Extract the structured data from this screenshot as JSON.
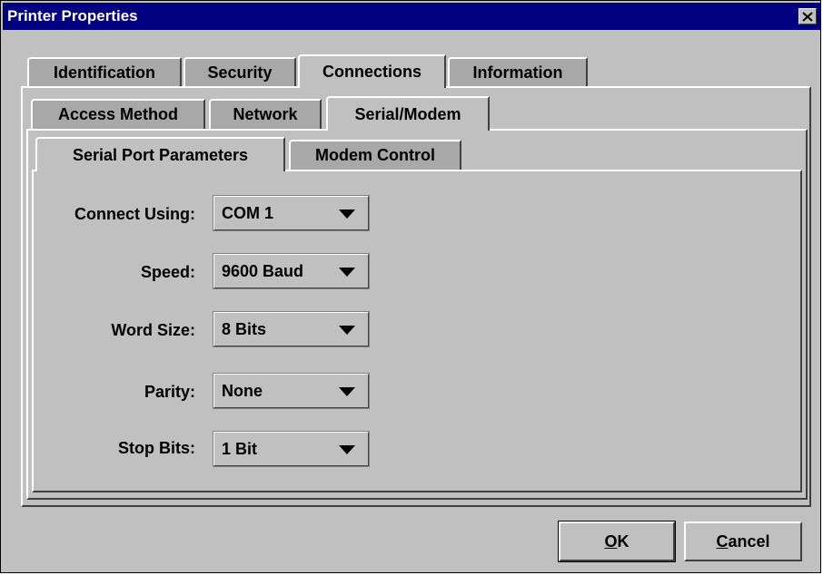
{
  "window": {
    "title": "Printer Properties"
  },
  "tabs_level1": [
    {
      "label": "Identification",
      "active": false
    },
    {
      "label": "Security",
      "active": false
    },
    {
      "label": "Connections",
      "active": true
    },
    {
      "label": "Information",
      "active": false
    }
  ],
  "tabs_level2": [
    {
      "label": "Access Method",
      "active": false
    },
    {
      "label": "Network",
      "active": false
    },
    {
      "label": "Serial/Modem",
      "active": true
    }
  ],
  "tabs_level3": [
    {
      "label": "Serial Port Parameters",
      "active": true
    },
    {
      "label": "Modem Control",
      "active": false
    }
  ],
  "form": {
    "connect_using": {
      "label": "Connect Using:",
      "value": "COM 1"
    },
    "speed": {
      "label": "Speed:",
      "value": "9600 Baud"
    },
    "word_size": {
      "label": "Word Size:",
      "value": "8 Bits"
    },
    "parity": {
      "label": "Parity:",
      "value": "None"
    },
    "stop_bits": {
      "label": "Stop Bits:",
      "value": "1 Bit"
    }
  },
  "buttons": {
    "ok": {
      "mnemonic": "O",
      "rest": "K"
    },
    "cancel": {
      "mnemonic": "C",
      "rest": "ancel"
    }
  },
  "colors": {
    "titlebar": "#000080",
    "face": "#c0c0c0",
    "inactive_tab": "#a8a8a8"
  }
}
